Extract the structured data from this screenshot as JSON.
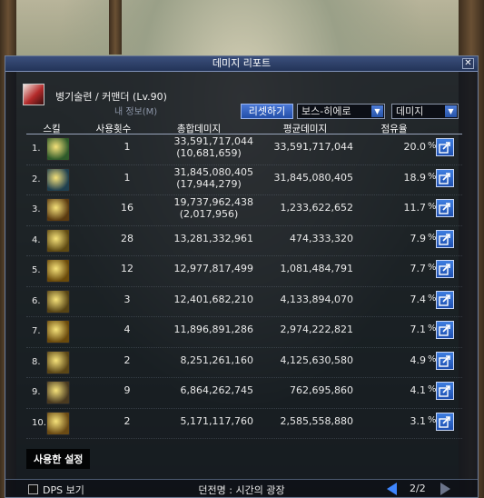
{
  "window": {
    "title": "데미지 리포트",
    "close_label": "✕"
  },
  "character": {
    "name_line": "병기술련 / 커맨더 (Lv.90)",
    "sub_label": "내 정보(M)"
  },
  "controls": {
    "reset_label": "리셋하기",
    "mode_value": "보스-히에로",
    "type_value": "데미지"
  },
  "table": {
    "headers": {
      "skill": "스킬",
      "uses": "사용횟수",
      "total": "총합데미지",
      "avg": "평균데미지",
      "share": "점유율"
    },
    "rows": [
      {
        "idx": "1.",
        "uses": "1",
        "total": "33,591,717,044",
        "total_sub": "(10,681,659)",
        "avg": "33,591,717,044",
        "share": "20.0",
        "pct": "%",
        "icon_color": "#2e5a2a"
      },
      {
        "idx": "2.",
        "uses": "1",
        "total": "31,845,080,405",
        "total_sub": "(17,944,279)",
        "avg": "31,845,080,405",
        "share": "18.9",
        "pct": "%",
        "icon_color": "#1f3f4f"
      },
      {
        "idx": "3.",
        "uses": "16",
        "total": "19,737,962,438",
        "total_sub": "(2,017,956)",
        "avg": "1,233,622,652",
        "share": "11.7",
        "pct": "%",
        "icon_color": "#5a3a10"
      },
      {
        "idx": "4.",
        "uses": "28",
        "total": "13,281,332,961",
        "total_sub": "",
        "avg": "474,333,320",
        "share": "7.9",
        "pct": "%",
        "icon_color": "#5f4a12"
      },
      {
        "idx": "5.",
        "uses": "12",
        "total": "12,977,817,499",
        "total_sub": "",
        "avg": "1,081,484,791",
        "share": "7.7",
        "pct": "%",
        "icon_color": "#6a4a0a"
      },
      {
        "idx": "6.",
        "uses": "3",
        "total": "12,401,682,210",
        "total_sub": "",
        "avg": "4,133,894,070",
        "share": "7.4",
        "pct": "%",
        "icon_color": "#574414"
      },
      {
        "idx": "7.",
        "uses": "4",
        "total": "11,896,891,286",
        "total_sub": "",
        "avg": "2,974,222,821",
        "share": "7.1",
        "pct": "%",
        "icon_color": "#6a4a0c"
      },
      {
        "idx": "8.",
        "uses": "2",
        "total": "8,251,261,160",
        "total_sub": "",
        "avg": "4,125,630,580",
        "share": "4.9",
        "pct": "%",
        "icon_color": "#5b4616"
      },
      {
        "idx": "9.",
        "uses": "9",
        "total": "6,864,262,745",
        "total_sub": "",
        "avg": "762,695,860",
        "share": "4.1",
        "pct": "%",
        "icon_color": "#4a3a20"
      },
      {
        "idx": "10.",
        "uses": "2",
        "total": "5,171,117,760",
        "total_sub": "",
        "avg": "2,585,558,880",
        "share": "3.1",
        "pct": "%",
        "icon_color": "#6a4a14"
      }
    ]
  },
  "footer": {
    "settings_label": "사용한 설정",
    "dps_label": "DPS 보기",
    "dungeon_label": "던전명 : 시간의 광장",
    "page_label": "2/2"
  }
}
